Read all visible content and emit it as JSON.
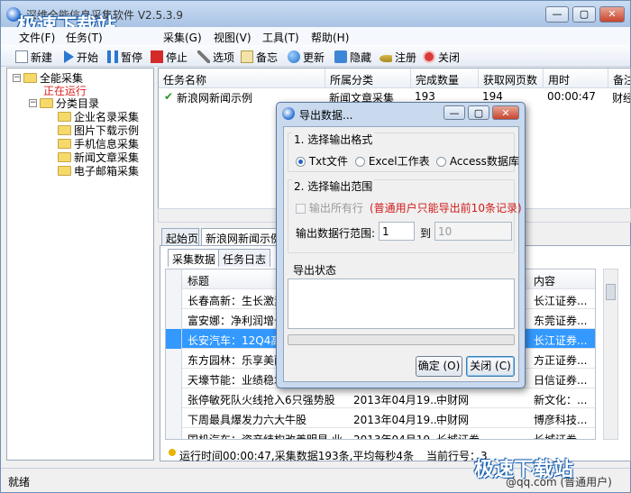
{
  "window": {
    "title": "深维全能信息采集软件 V2.5.3.9",
    "buttons": {
      "minimize": "—",
      "maximize": "▢",
      "close": "✕"
    }
  },
  "watermark": {
    "top": "极速下载站",
    "bottom": "极速下载站"
  },
  "menu": {
    "items": [
      "文件(F)",
      "任务(T)",
      "采集(G)",
      "视图(V)",
      "工具(T)",
      "帮助(H)"
    ]
  },
  "toolbar": {
    "items": [
      {
        "label": "新建",
        "icon": "new-doc-icon"
      },
      {
        "label": "开始",
        "icon": "play-icon"
      },
      {
        "label": "暂停",
        "icon": "pause-icon"
      },
      {
        "label": "停止",
        "icon": "stop-icon"
      },
      {
        "label": "选项",
        "icon": "wrench-icon"
      },
      {
        "label": "备忘",
        "icon": "memo-icon"
      },
      {
        "label": "更新",
        "icon": "globe-icon"
      },
      {
        "label": "隐藏",
        "icon": "hide-icon"
      },
      {
        "label": "注册",
        "icon": "key-icon"
      },
      {
        "label": "关闭",
        "icon": "power-icon"
      }
    ]
  },
  "tree": {
    "root": "全能采集",
    "running": "正在运行",
    "category": "分类目录",
    "children": [
      "企业名录采集",
      "图片下载示例",
      "手机信息采集",
      "新闻文章采集",
      "电子邮箱采集"
    ]
  },
  "tasks": {
    "headers": [
      "任务名称",
      "所属分类",
      "完成数量",
      "获取网页数",
      "用时",
      "备注"
    ],
    "rows": [
      {
        "name": "新浪网新闻示例",
        "category": "新闻文章采集",
        "done": "193",
        "pages": "194",
        "time": "00:00:47",
        "note": "财经"
      }
    ]
  },
  "tabs": {
    "start": "起始页",
    "current": "新浪网新闻示例"
  },
  "subtabs": {
    "data": "采集数据",
    "log": "任务日志"
  },
  "grid": {
    "headers": [
      "标题",
      "",
      "",
      "内容"
    ],
    "rows": [
      {
        "title": "长春高新：生长激素高",
        "date": "",
        "source": "",
        "content": "长江证券..."
      },
      {
        "title": "富安娜：净利润增长",
        "date": "",
        "source": "",
        "content": "东莞证券..."
      },
      {
        "title": "长安汽车：12Q4高增",
        "date": "",
        "source": "",
        "content": "长江证券..."
      },
      {
        "title": "东方园林：乐享美丽中",
        "date": "",
        "source": "",
        "content": "方正证券..."
      },
      {
        "title": "天壕节能：业绩稳增",
        "date": "",
        "source": "",
        "content": "日信证券..."
      },
      {
        "title": "张停敏死队火线抢入6只强势股",
        "date": "2013年04月19...",
        "source": "中财网",
        "content": "新文化：..."
      },
      {
        "title": "下周最具爆发力六大牛股",
        "date": "2013年04月19...",
        "source": "中财网",
        "content": "博彦科技..."
      },
      {
        "title": "国机汽车：资产结构改善明显 业...",
        "date": "2013年04月19...",
        "source": "长城证券",
        "content": "长城证券..."
      }
    ]
  },
  "status": {
    "run": "运行时间00:00:47,采集数据193条,平均每秒4条",
    "row": "当前行号：3",
    "ready": "就绪",
    "user": "@qq.com (普通用户)"
  },
  "dialog": {
    "title": "导出数据...",
    "section1": "1. 选择输出格式",
    "formats": [
      "Txt文件",
      "Excel工作表",
      "Access数据库"
    ],
    "section2": "2. 选择输出范围",
    "all_rows": "输出所有行",
    "notice": "(普通用户只能导出前10条记录)",
    "range_label": "输出数据行范围:",
    "range_from": "1",
    "range_to_label": "到",
    "range_to": "10",
    "section3": "导出状态",
    "ok": "确定 (O)",
    "close": "关闭 (C)"
  }
}
